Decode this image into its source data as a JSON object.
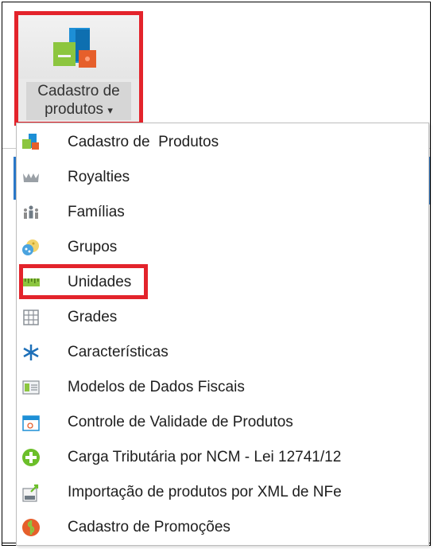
{
  "ribbon": {
    "button_line1": "Cadastro de",
    "button_line2": "produtos",
    "dropdown_arrow": "▾",
    "icon": "product-box-icon"
  },
  "menu": {
    "items": [
      {
        "label": "Cadastro de  Produtos",
        "icon": "product-box-icon"
      },
      {
        "label": "Royalties",
        "icon": "crown-icon"
      },
      {
        "label": "Famílias",
        "icon": "people-group-icon"
      },
      {
        "label": "Grupos",
        "icon": "group-dots-icon"
      },
      {
        "label": "Unidades",
        "icon": "ruler-icon"
      },
      {
        "label": "Grades",
        "icon": "grid-icon"
      },
      {
        "label": "Características",
        "icon": "asterisk-icon"
      },
      {
        "label": "Modelos de Dados Fiscais",
        "icon": "fiscal-card-icon"
      },
      {
        "label": "Controle de Validade de Produtos",
        "icon": "calendar-icon"
      },
      {
        "label": "Carga Tributária por NCM - Lei 12741/12",
        "icon": "plus-circle-icon"
      },
      {
        "label": "Importação de produtos por XML de NFe",
        "icon": "xml-import-icon"
      },
      {
        "label": "Cadastro de Promoções",
        "icon": "promo-dollar-icon"
      }
    ]
  },
  "colors": {
    "highlight": "#e3232b",
    "accent_blue": "#2a78c8"
  }
}
